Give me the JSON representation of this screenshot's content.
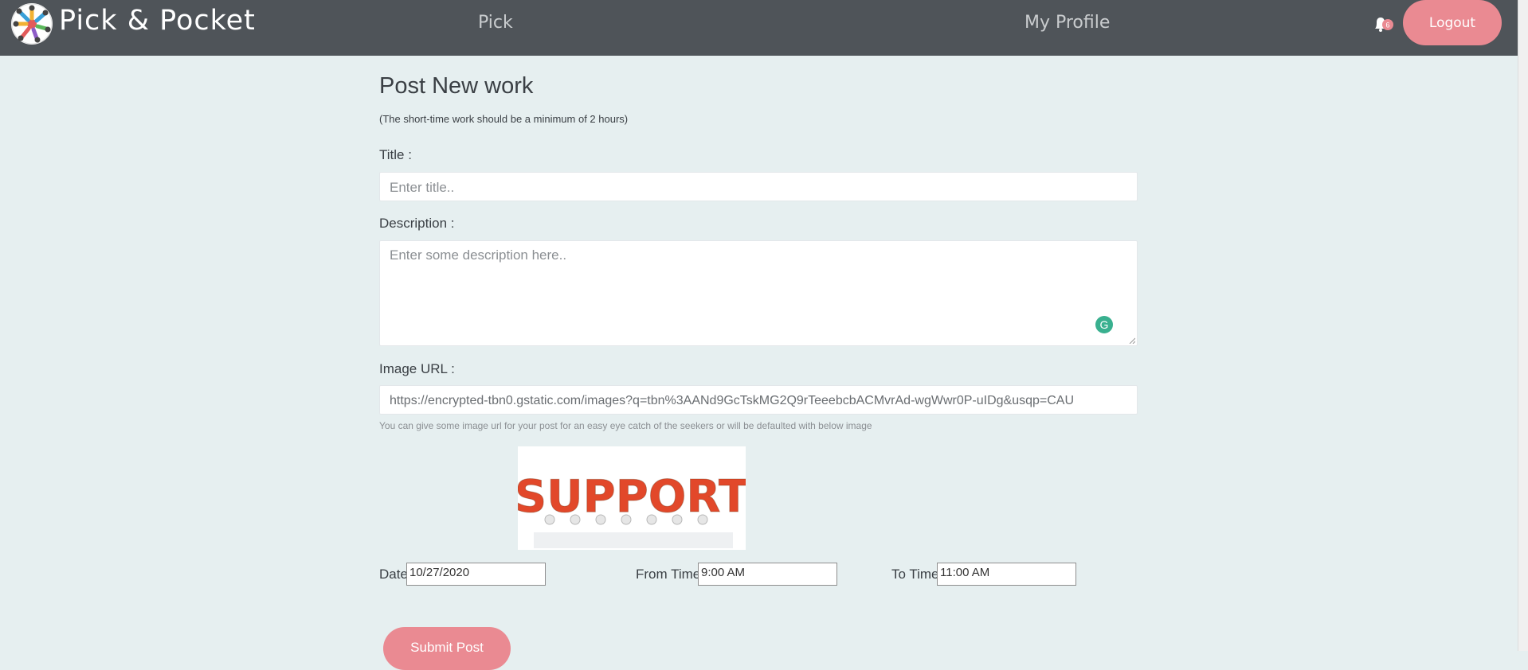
{
  "header": {
    "brand": "Pick & Pocket",
    "nav": [
      "Pick",
      "My Profile"
    ],
    "logout_label": "Logout",
    "notification_count": "6"
  },
  "form": {
    "heading": "Post New work",
    "subnote": "(The short-time work should be a minimum of 2 hours)",
    "title_label": "Title :",
    "title_placeholder": "Enter title..",
    "description_label": "Description :",
    "description_placeholder": "Enter some description here..",
    "image_url_label": "Image URL :",
    "image_url_value": "https://encrypted-tbn0.gstatic.com/images?q=tbn%3AANd9GcTskMG2Q9rTeeebcbACMvrAd-wgWwr0P-uIDg&usqp=CAU",
    "image_hint": "You can give some image url for your post for an easy eye catch of the seekers or will be defaulted with below image",
    "preview_text": "SUPPORT",
    "date_label": "Date",
    "date_value": "10/27/2020",
    "from_label": "From Time",
    "from_value": "9:00 AM",
    "to_label": "To Time",
    "to_value": "11:00 AM",
    "submit_label": "Submit Post"
  },
  "colors": {
    "navbar": "#4f5459",
    "accent": "#ea8a92",
    "page_bg": "#e6eff0",
    "grammarly": "#39b08f"
  },
  "icons": [
    "logo-icon",
    "bell-icon",
    "grammarly-icon",
    "resize-handle-icon"
  ]
}
